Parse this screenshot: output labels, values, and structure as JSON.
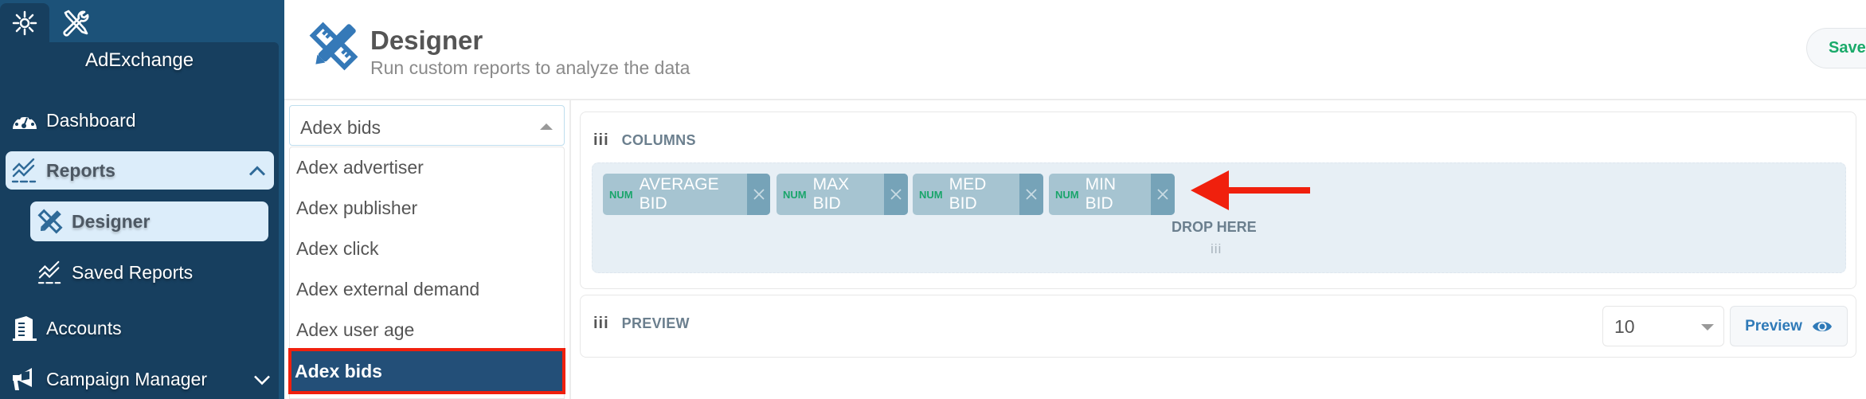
{
  "sidebar": {
    "tabs": [
      {
        "icon": "network-search-icon",
        "active": true
      },
      {
        "icon": "tools-icon",
        "active": false
      }
    ],
    "brand": "AdExchange",
    "items": [
      {
        "label": "Dashboard",
        "icon": "dashboard-gauge-icon"
      },
      {
        "label": "Reports",
        "icon": "chart-line-icon",
        "expanded": true
      },
      {
        "label": "Designer",
        "icon": "ruler-pencil-icon",
        "active": true
      },
      {
        "label": "Saved Reports",
        "icon": "chart-line-icon"
      },
      {
        "label": "Accounts",
        "icon": "building-icon"
      },
      {
        "label": "Campaign Manager",
        "icon": "megaphone-icon",
        "expanded": false
      }
    ]
  },
  "header": {
    "title": "Designer",
    "subtitle": "Run custom reports to analyze the data",
    "save_label": "Save"
  },
  "source_select": {
    "value": "Adex bids",
    "options": [
      "Adex advertiser",
      "Adex publisher",
      "Adex click",
      "Adex external demand",
      "Adex user age",
      "Adex bids"
    ],
    "selected_index": 5
  },
  "columns": {
    "title": "COLUMNS",
    "chips": [
      {
        "type": "NUM",
        "label": "AVERAGE BID"
      },
      {
        "type": "NUM",
        "label": "MAX BID"
      },
      {
        "type": "NUM",
        "label": "MED BID"
      },
      {
        "type": "NUM",
        "label": "MIN BID"
      }
    ],
    "drop_label": "DROP HERE",
    "drop_grip": "iii"
  },
  "preview": {
    "title": "PREVIEW",
    "rows_value": "10",
    "button_label": "Preview"
  },
  "grip": "iii",
  "colors": {
    "sidebar_bg": "#1c5279",
    "sidebar_panel": "#173f5f",
    "highlight": "#dcedfa",
    "accent_blue": "#2f7ab8",
    "save_green": "#1aaa6a",
    "chip_bg": "#a6c4d1",
    "chip_close_bg": "#76a3b8",
    "selected_item": "#234f78",
    "annotation_red": "#f0200d"
  }
}
